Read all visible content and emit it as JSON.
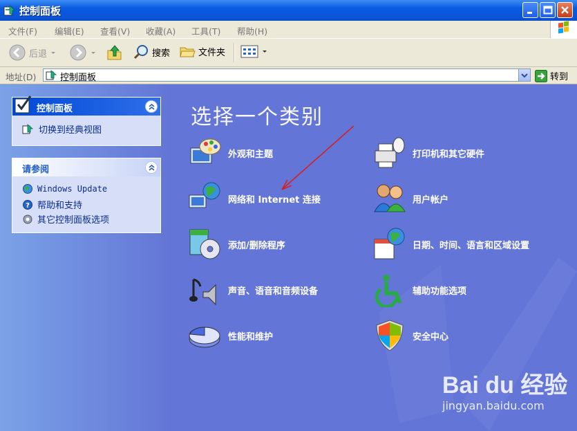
{
  "window": {
    "title": "控制面板"
  },
  "menu": [
    "文件(F)",
    "编辑(E)",
    "查看(V)",
    "收藏(A)",
    "工具(T)",
    "帮助(H)"
  ],
  "toolbar": {
    "back": "后退",
    "search": "搜索",
    "folders": "文件夹"
  },
  "address": {
    "label": "地址(D)",
    "value": "控制面板",
    "go": "转到"
  },
  "sidebar": {
    "panel1": {
      "title": "控制面板",
      "link": "切换到经典视图"
    },
    "panel2": {
      "title": "请参阅",
      "links": [
        "Windows Update",
        "帮助和支持",
        "其它控制面板选项"
      ]
    }
  },
  "main": {
    "heading": "选择一个类别",
    "categories": [
      "外观和主题",
      "打印机和其它硬件",
      "网络和 Internet 连接",
      "用户帐户",
      "添加/删除程序",
      "日期、时间、语言和区域设置",
      "声音、语音和音频设备",
      "辅助功能选项",
      "性能和维护",
      "安全中心"
    ]
  },
  "watermark": {
    "brand": "Bai du 经验",
    "url": "jingyan.baidu.com"
  },
  "colors": {
    "title_bar": "#0a5be0",
    "main_bg": "#6375d6",
    "panel_bg": "#d6dff7",
    "link": "#0b2d90",
    "annotation_arrow": "#d62020"
  }
}
